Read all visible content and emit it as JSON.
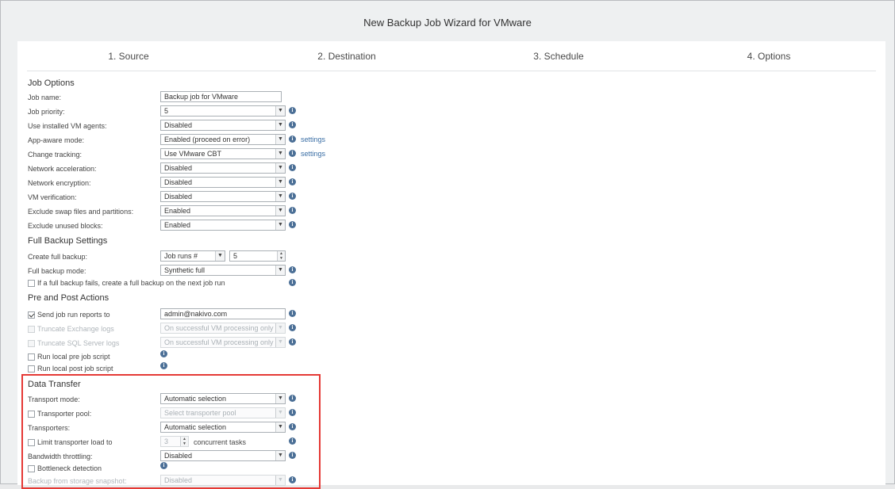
{
  "window": {
    "title": "New Backup Job Wizard for VMware"
  },
  "steps": [
    "1. Source",
    "2. Destination",
    "3. Schedule",
    "4. Options"
  ],
  "sections": {
    "job_options": "Job Options",
    "full_backup": "Full Backup Settings",
    "pre_post": "Pre and Post Actions",
    "data_transfer": "Data Transfer"
  },
  "job_options": {
    "job_name": {
      "label": "Job name:",
      "value": "Backup job for VMware"
    },
    "job_priority": {
      "label": "Job priority:",
      "value": "5"
    },
    "vm_agents": {
      "label": "Use installed VM agents:",
      "value": "Disabled"
    },
    "app_aware": {
      "label": "App-aware mode:",
      "value": "Enabled (proceed on error)",
      "link": "settings"
    },
    "change_tracking": {
      "label": "Change tracking:",
      "value": "Use VMware CBT",
      "link": "settings"
    },
    "net_accel": {
      "label": "Network acceleration:",
      "value": "Disabled"
    },
    "net_encrypt": {
      "label": "Network encryption:",
      "value": "Disabled"
    },
    "vm_verify": {
      "label": "VM verification:",
      "value": "Disabled"
    },
    "exclude_swap": {
      "label": "Exclude swap files and partitions:",
      "value": "Enabled"
    },
    "exclude_unused": {
      "label": "Exclude unused blocks:",
      "value": "Enabled"
    }
  },
  "full_backup": {
    "create": {
      "label": "Create full backup:",
      "value": "Job runs #",
      "count": "5"
    },
    "mode": {
      "label": "Full backup mode:",
      "value": "Synthetic full"
    },
    "fail_checkbox": {
      "label": "If a full backup fails, create a full backup on the next job run",
      "checked": false
    }
  },
  "pre_post": {
    "send_reports": {
      "label": "Send job run reports to",
      "checked": true,
      "value": "admin@nakivo.com"
    },
    "truncate_exchange": {
      "label": "Truncate Exchange logs",
      "value": "On successful VM processing only"
    },
    "truncate_sql": {
      "label": "Truncate SQL Server logs",
      "value": "On successful VM processing only"
    },
    "pre_script": {
      "label": "Run local pre job script"
    },
    "post_script": {
      "label": "Run local post job script"
    }
  },
  "data_transfer": {
    "transport_mode": {
      "label": "Transport mode:",
      "value": "Automatic selection"
    },
    "transporter_pool": {
      "label": "Transporter pool:",
      "placeholder": "Select transporter pool"
    },
    "transporters": {
      "label": "Transporters:",
      "value": "Automatic selection"
    },
    "limit_load": {
      "label": "Limit transporter load to",
      "value": "3",
      "suffix": "concurrent tasks"
    },
    "bandwidth": {
      "label": "Bandwidth throttling:",
      "value": "Disabled"
    },
    "bottleneck": {
      "label": "Bottleneck detection"
    },
    "storage_snapshot": {
      "label": "Backup from storage snapshot:",
      "value": "Disabled"
    }
  },
  "icons": {
    "info": "info-icon",
    "dropdown": "chevron-down-icon",
    "spinner": "spinner-arrows-icon"
  },
  "colors": {
    "highlight": "#e53935",
    "link": "#3a6ea5",
    "info": "#4b6f96"
  },
  "glyphs": {
    "info": "i",
    "chevron": "▼",
    "spin_up": "▲",
    "spin_down": "▼"
  }
}
